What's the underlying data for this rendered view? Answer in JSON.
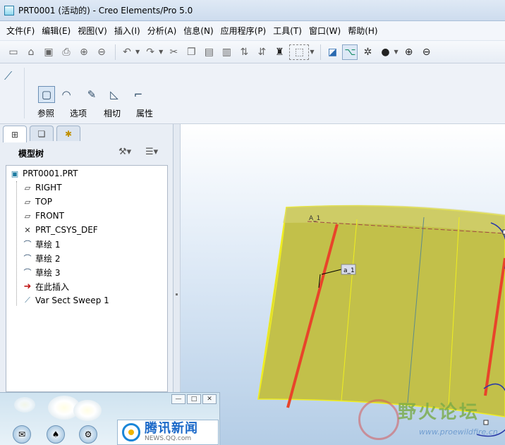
{
  "window": {
    "title": "PRT0001 (活动的) - Creo Elements/Pro 5.0"
  },
  "menu": [
    "文件(F)",
    "编辑(E)",
    "视图(V)",
    "插入(I)",
    "分析(A)",
    "信息(N)",
    "应用程序(P)",
    "工具(T)",
    "窗口(W)",
    "帮助(H)"
  ],
  "toolbar": {
    "icons": [
      "new-icon",
      "open-icon",
      "save-icon",
      "print-icon",
      "send-icon",
      "email-icon",
      "undo-icon",
      "redo-icon",
      "cut-icon",
      "copy-icon",
      "paste-icon",
      "paste-special-icon",
      "regenerate-icon",
      "regen-manager-icon",
      "find-icon",
      "select-box-icon",
      "datum-plane-display-icon",
      "datum-axis-display-icon",
      "datum-point-display-icon",
      "shading-icon",
      "zoom-in-icon",
      "zoom-out-icon"
    ]
  },
  "dashboard": {
    "buttons": [
      {
        "label": "参照",
        "icon": "references-icon",
        "active": true
      },
      {
        "label": "选项",
        "icon": "options-icon",
        "active": false
      },
      {
        "label": "相切",
        "icon": "tangency-icon",
        "active": false
      },
      {
        "label": "属性",
        "icon": "properties-icon",
        "active": false
      }
    ]
  },
  "model_tree": {
    "title": "模型树",
    "root": "PRT0001.PRT",
    "items": [
      {
        "label": "RIGHT",
        "icon": "datum-plane-icon"
      },
      {
        "label": "TOP",
        "icon": "datum-plane-icon"
      },
      {
        "label": "FRONT",
        "icon": "datum-plane-icon"
      },
      {
        "label": "PRT_CSYS_DEF",
        "icon": "csys-icon"
      },
      {
        "label": "草绘 1",
        "icon": "sketch-icon"
      },
      {
        "label": "草绘 2",
        "icon": "sketch-icon"
      },
      {
        "label": "草绘 3",
        "icon": "sketch-icon"
      },
      {
        "label": "在此插入",
        "icon": "insert-here-icon"
      },
      {
        "label": "Var Sect Sweep 1",
        "icon": "sweep-feature-icon"
      }
    ]
  },
  "graphics": {
    "labels": {
      "axis": "A_1",
      "dim": "a_1"
    },
    "colors": {
      "surface": "#c2c04a",
      "trajectory": "#e8442a",
      "edge": "#f0ee20",
      "sketch": "#2a3aa8"
    }
  },
  "taskbar": {
    "brand_main": "腾讯新闻",
    "brand_sub": "NEWS.QQ.com"
  },
  "watermark": {
    "main": "野火论坛",
    "sub": "www.proewildfire.cn"
  }
}
